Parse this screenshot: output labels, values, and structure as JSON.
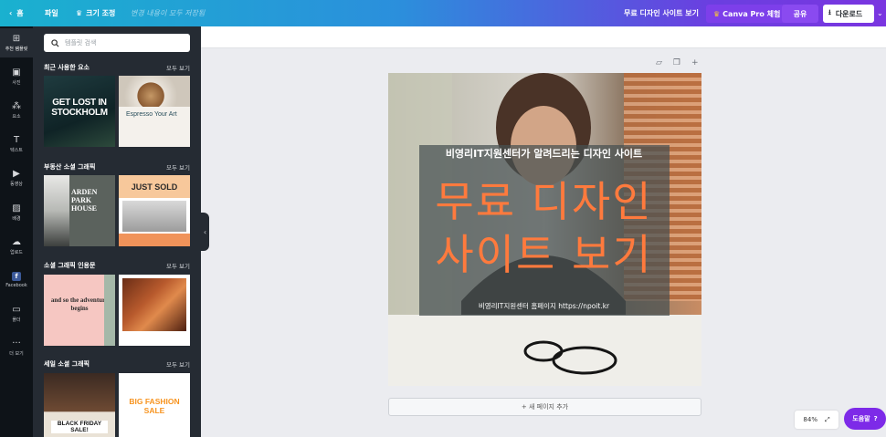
{
  "header": {
    "home_label": "홈",
    "file_label": "파일",
    "resize_label": "크기 조정",
    "save_status": "변경 내용이 모두 저장됨",
    "doc_title": "무료 디자인 사이트 보기",
    "pro_label": "Canva Pro 체험",
    "share_label": "공유",
    "download_label": "다운로드"
  },
  "rail": {
    "items": [
      {
        "label": "추천 템플릿",
        "icon": "template-icon"
      },
      {
        "label": "사진",
        "icon": "photo-icon"
      },
      {
        "label": "요소",
        "icon": "elements-icon"
      },
      {
        "label": "텍스트",
        "icon": "text-icon"
      },
      {
        "label": "동영상",
        "icon": "video-icon"
      },
      {
        "label": "배경",
        "icon": "background-icon"
      },
      {
        "label": "업로드",
        "icon": "upload-icon"
      },
      {
        "label": "Facebook",
        "icon": "facebook-icon"
      },
      {
        "label": "폴더",
        "icon": "folder-icon"
      },
      {
        "label": "더 보기",
        "icon": "more-icon"
      }
    ]
  },
  "panel": {
    "search_placeholder": "템플릿 검색",
    "see_all": "모두 보기",
    "sections": [
      {
        "title": "최근 사용한 요소"
      },
      {
        "title": "부동산 소셜 그래픽"
      },
      {
        "title": "소셜 그래픽 인용문"
      },
      {
        "title": "세일 소셜 그래픽"
      }
    ],
    "thumbs": {
      "stockholm": "GET LOST IN STOCKHOLM",
      "espresso": "Espresso Your Art",
      "arden": "ARDEN PARK HOUSE",
      "just_sold": "JUST SOLD",
      "quote": "and so the adventure begins",
      "black_friday": "BLACK FRIDAY SALE!",
      "big_fashion": "BIG FASHION SALE"
    }
  },
  "canvas": {
    "subtitle": "비영리IT지원센터가 알려드리는 디자인 사이트",
    "headline_line1": "무료 디자인",
    "headline_line2": "사이트 보기",
    "footer": "비영리IT지원센터 홈페이지 https://npoit.kr",
    "add_page": "+ 새 페이지 추가",
    "zoom": "84%",
    "help": "도움말"
  },
  "colors": {
    "accent_purple": "#7d2ae8",
    "headline_orange": "#ff7a3d",
    "panel_bg": "#252b33",
    "rail_bg": "#0e1318"
  }
}
